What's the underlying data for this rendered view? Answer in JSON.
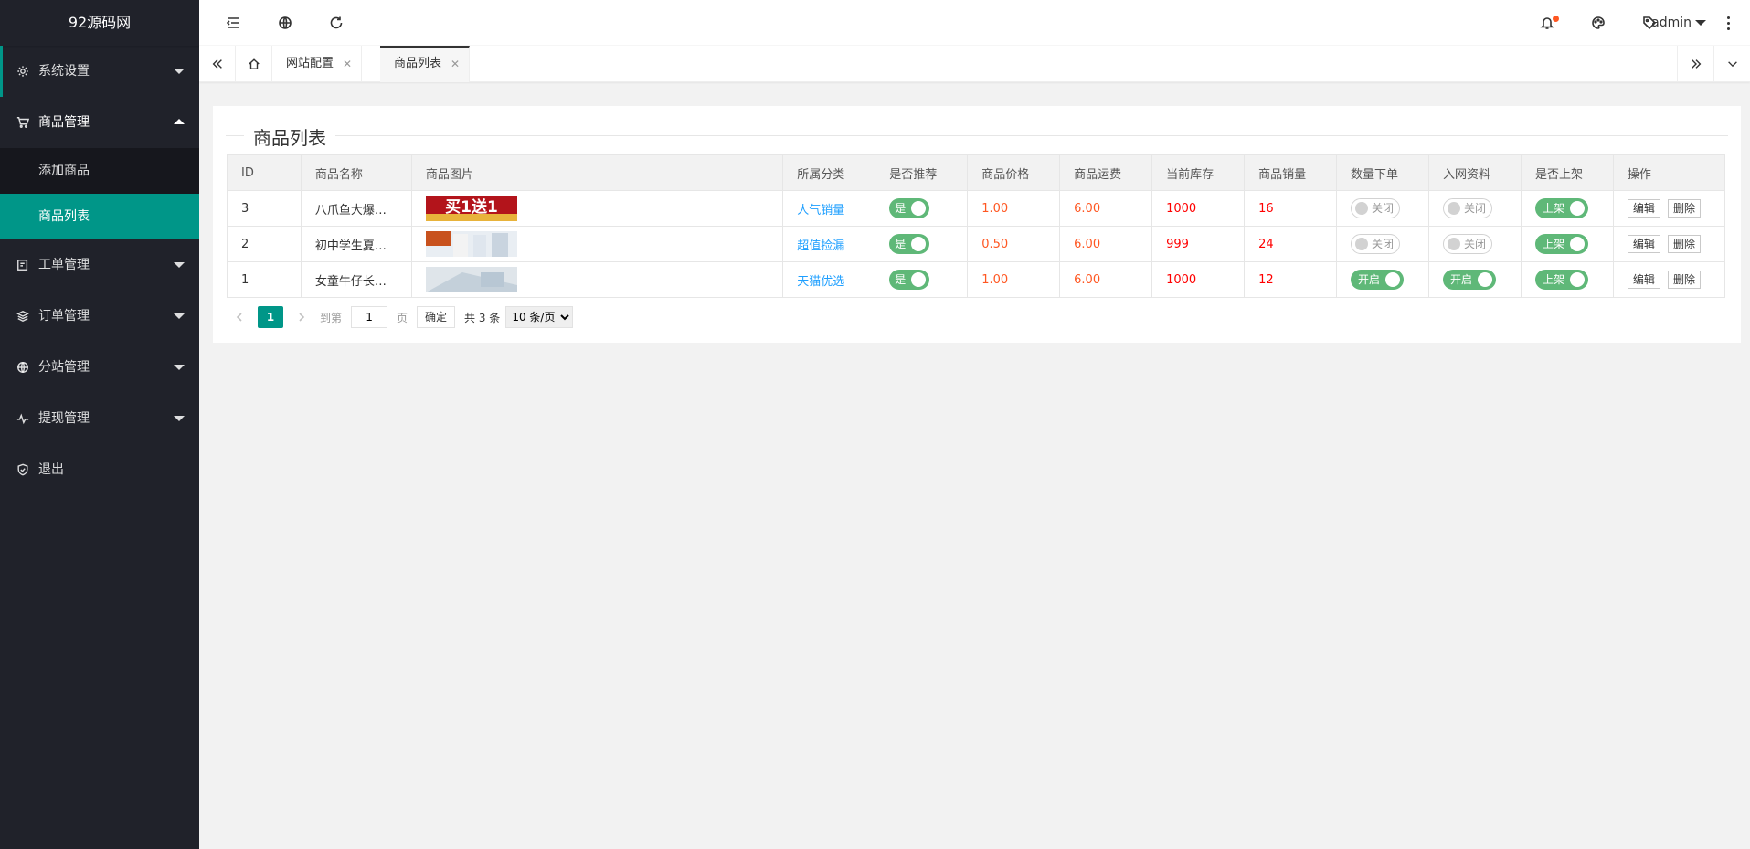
{
  "sidebar": {
    "logo": "92源码网",
    "items": [
      {
        "label": "系统设置",
        "icon": "gear-icon"
      },
      {
        "label": "商品管理",
        "icon": "cart-icon"
      },
      {
        "label": "工单管理",
        "icon": "ticket-icon"
      },
      {
        "label": "订单管理",
        "icon": "layers-icon"
      },
      {
        "label": "分站管理",
        "icon": "globe-icon"
      },
      {
        "label": "提现管理",
        "icon": "pulse-icon"
      },
      {
        "label": "退出",
        "icon": "shield-icon"
      }
    ],
    "sub_items": [
      "添加商品",
      "商品列表"
    ]
  },
  "header": {
    "user": "admin"
  },
  "tabs": [
    "网站配置",
    "商品列表"
  ],
  "page": {
    "title": "商品列表",
    "columns": [
      "ID",
      "商品名称",
      "商品图片",
      "所属分类",
      "是否推荐",
      "商品价格",
      "商品运费",
      "当前库存",
      "商品销量",
      "数量下单",
      "入网资料",
      "是否上架",
      "操作"
    ],
    "rows": [
      {
        "id": "3",
        "name": "八爪鱼大爆…",
        "img_text": "买1送1",
        "category": "人气销量",
        "recommend": "是",
        "price": "1.00",
        "shipping": "6.00",
        "stock": "1000",
        "sales": "16",
        "qty_order": "关闭",
        "network": "关闭",
        "on_shelf": "上架",
        "edit": "编辑",
        "delete": "删除"
      },
      {
        "id": "2",
        "name": "初中学生夏…",
        "img_text": "",
        "category": "超值捡漏",
        "recommend": "是",
        "price": "0.50",
        "shipping": "6.00",
        "stock": "999",
        "sales": "24",
        "qty_order": "关闭",
        "network": "关闭",
        "on_shelf": "上架",
        "edit": "编辑",
        "delete": "删除"
      },
      {
        "id": "1",
        "name": "女童牛仔长…",
        "img_text": "",
        "category": "天猫优选",
        "recommend": "是",
        "price": "1.00",
        "shipping": "6.00",
        "stock": "1000",
        "sales": "12",
        "qty_order": "开启",
        "network": "开启",
        "on_shelf": "上架",
        "edit": "编辑",
        "delete": "删除"
      }
    ]
  },
  "pager": {
    "current": "1",
    "goto_label": "到第",
    "page_input": "1",
    "page_unit": "页",
    "confirm": "确定",
    "total": "共 3 条",
    "per_page": "10 条/页"
  },
  "colors": {
    "accent": "#009688",
    "sidebar": "#20222a",
    "switch_on": "#5FB878",
    "price": "#ff5722",
    "link": "#1e9fff"
  }
}
